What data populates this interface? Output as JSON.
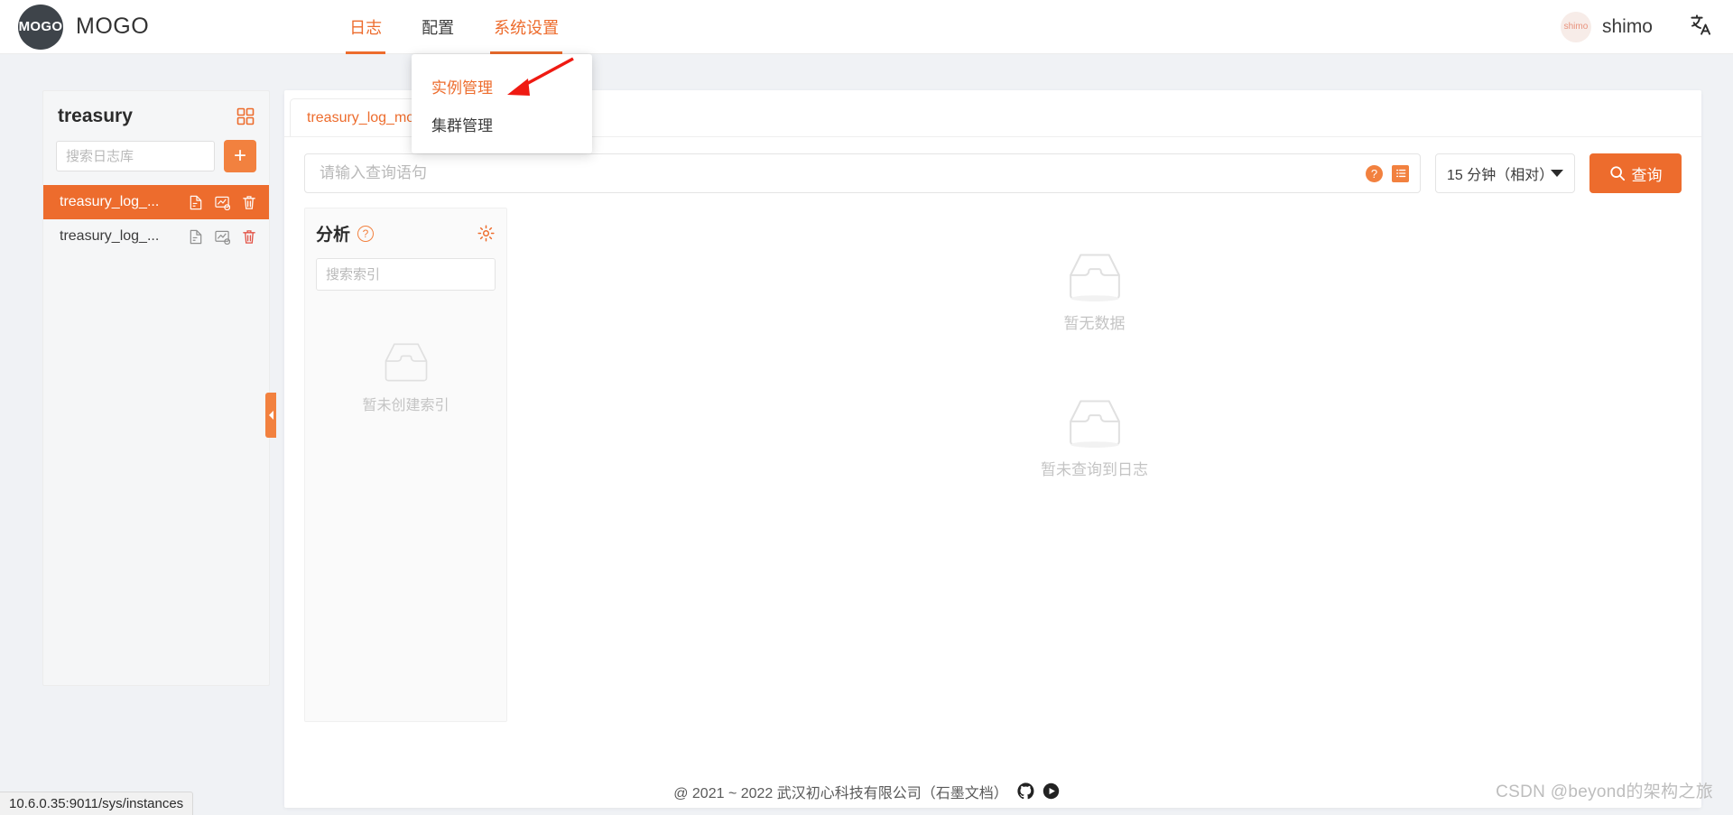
{
  "header": {
    "logo_text": "MOGO",
    "brand_name": "MOGO",
    "nav": [
      {
        "label": "日志",
        "state": "active"
      },
      {
        "label": "配置",
        "state": "normal"
      },
      {
        "label": "系统设置",
        "state": "open"
      }
    ],
    "avatar_text": "shimo",
    "user_name": "shimo",
    "lang_icon_glyph": "文"
  },
  "dropdown": {
    "items": [
      {
        "label": "实例管理",
        "active": true
      },
      {
        "label": "集群管理",
        "active": false
      }
    ]
  },
  "sidebar": {
    "title": "treasury",
    "search_placeholder": "搜索日志库",
    "search_value": "",
    "add_label": "+",
    "items": [
      {
        "name": "treasury_log_...",
        "selected": true
      },
      {
        "name": "treasury_log_...",
        "selected": false
      }
    ]
  },
  "tabs": [
    {
      "label": "treasury_log_mo",
      "active": true
    }
  ],
  "query": {
    "placeholder": "请输入查询语句",
    "value": "",
    "help_glyph": "?",
    "time_range": "15 分钟（相对）",
    "search_button": "查询"
  },
  "analysis": {
    "title": "分析",
    "help_glyph": "?",
    "search_placeholder": "搜索索引",
    "search_value": "",
    "empty_text": "暂未创建索引"
  },
  "results": {
    "empty_chart_text": "暂无数据",
    "empty_logs_text": "暂未查询到日志"
  },
  "footer": {
    "copyright": "@ 2021 ~ 2022 武汉初心科技有限公司（石墨文档）"
  },
  "status_bar": {
    "url": "10.6.0.35:9011/sys/instances"
  },
  "watermark": {
    "text": "CSDN @beyond的架构之旅"
  },
  "colors": {
    "accent": "#ed6c2d",
    "accent_light": "#f2813f",
    "danger": "#e24a3c",
    "page_bg": "#f0f2f5",
    "panel_bg": "#f5f6f7",
    "muted_text": "#c4c4c4"
  }
}
